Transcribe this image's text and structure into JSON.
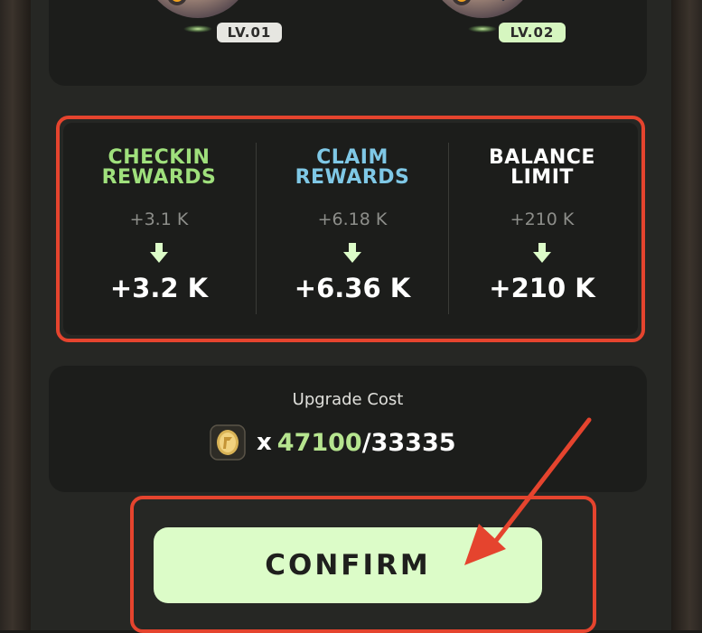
{
  "levels": {
    "current": "LV.01",
    "next": "LV.02"
  },
  "stats": [
    {
      "title_line1": "CHECKIN",
      "title_line2": "REWARDS",
      "old_value": "+3.1 K",
      "new_value": "+3.2 K",
      "title_color": "#9fe07c"
    },
    {
      "title_line1": "CLAIM",
      "title_line2": "REWARDS",
      "old_value": "+6.18 K",
      "new_value": "+6.36 K",
      "title_color": "#7fc8e6"
    },
    {
      "title_line1": "BALANCE",
      "title_line2": "LIMIT",
      "old_value": "+210 K",
      "new_value": "+210 K",
      "title_color": "#ffffff"
    }
  ],
  "upgrade": {
    "label": "Upgrade Cost",
    "multiplier": "x",
    "balance": "47100",
    "separator": "/",
    "cost": "33335",
    "coin_icon": "coin-icon"
  },
  "confirm": {
    "label": "CONFIRM"
  },
  "colors": {
    "highlight": "#e5442e",
    "accent_green": "#dcfcc8",
    "balance_green": "#b6e58f",
    "arrow_green": "#dcfcc8",
    "panel": "#1c1d1b"
  }
}
